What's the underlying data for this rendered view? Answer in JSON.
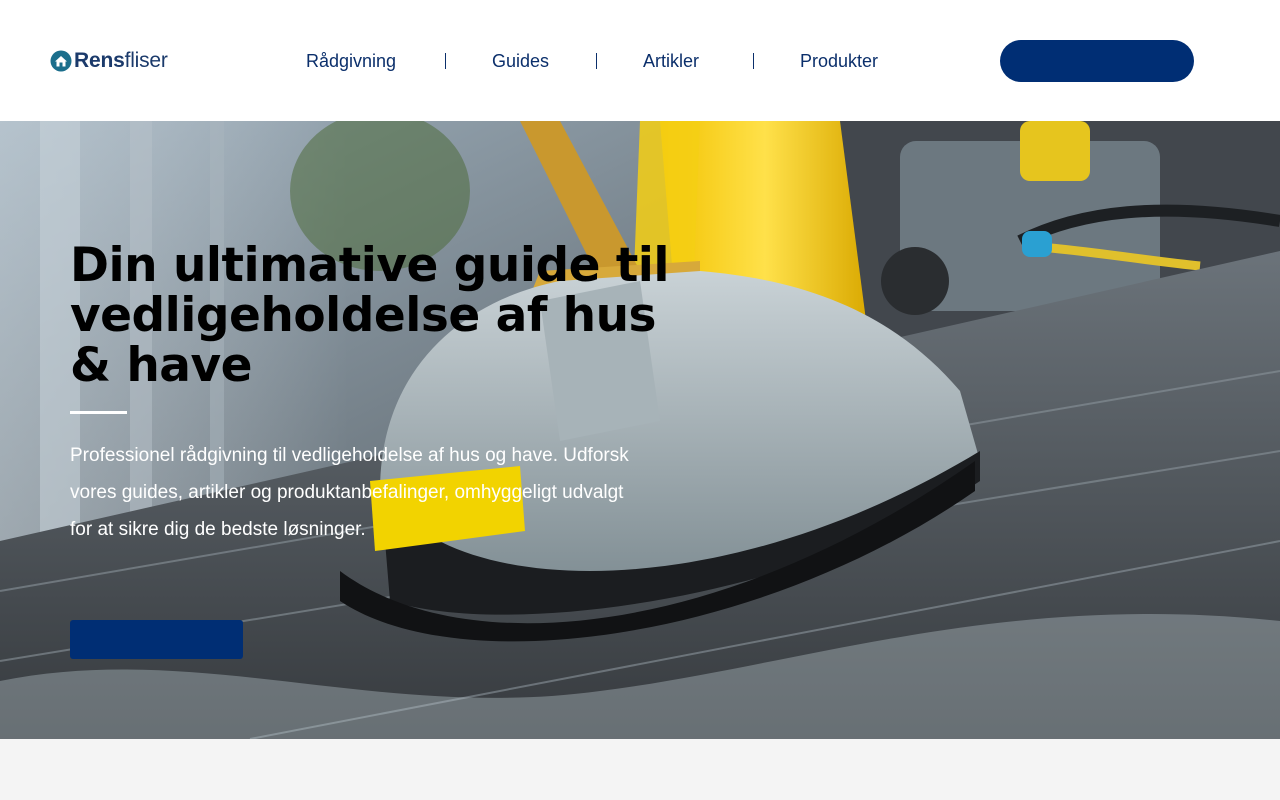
{
  "brand": {
    "name_bold": "Rens",
    "name_light": "fliser",
    "logo_icon": "house-icon",
    "color": "#1b3a6b"
  },
  "nav": {
    "items": [
      {
        "label": "Rådgivning"
      },
      {
        "label": "Guides"
      },
      {
        "label": "Artikler"
      },
      {
        "label": "Produkter"
      }
    ]
  },
  "header": {
    "cta_label": "",
    "cta_color": "#002e74"
  },
  "hero": {
    "title": "Din ultimative guide til vedligeholdelse af hus & have",
    "description": "Professionel rådgivning til vedligeholdelse af hus og have. Udforsk vores guides, artikler og produktanbefalinger, omhyggeligt udvalgt for at sikre dig de bedste løsninger.",
    "cta_label": "",
    "cta_color": "#002e74",
    "image_description": "surface cleaner scrubbing wet patio tiles"
  },
  "colors": {
    "accent": "#002e74",
    "nav_text": "#0b2f6b",
    "page_background": "#f4f4f4"
  }
}
